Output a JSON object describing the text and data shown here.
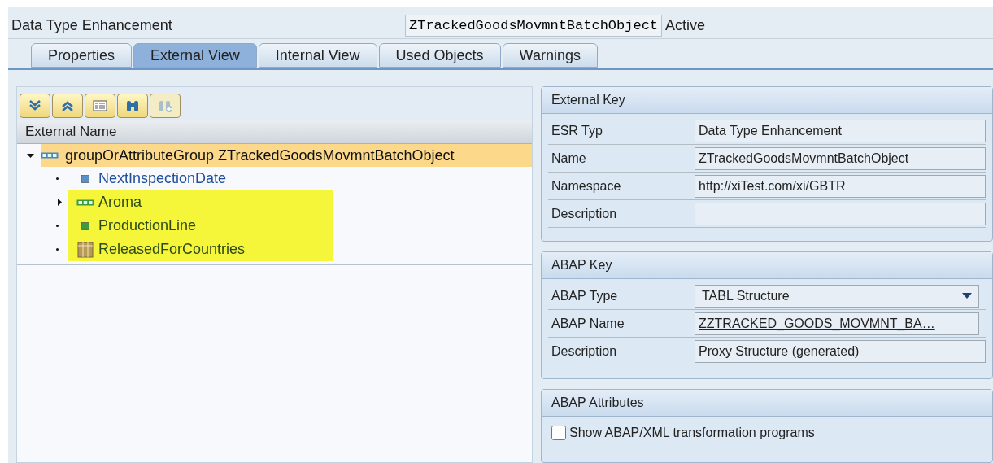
{
  "header": {
    "label": "Data Type Enhancement",
    "object_name": "ZTrackedGoodsMovmntBatchObject",
    "status": "Active"
  },
  "tabs": [
    {
      "label": "Properties",
      "selected": false
    },
    {
      "label": "External View",
      "selected": true
    },
    {
      "label": "Internal View",
      "selected": false
    },
    {
      "label": "Used Objects",
      "selected": false
    },
    {
      "label": "Warnings",
      "selected": false
    }
  ],
  "toolbar": [
    {
      "kind": "expand",
      "disabled": false
    },
    {
      "kind": "collapse",
      "disabled": false
    },
    {
      "kind": "details",
      "disabled": false
    },
    {
      "kind": "find",
      "disabled": false
    },
    {
      "kind": "find-next",
      "disabled": true
    }
  ],
  "tree": {
    "column": "External Name",
    "root": {
      "name": "groupOrAttributeGroup ZTrackedGoodsMovmntBatchObject",
      "expanded": true,
      "selected": true,
      "children": [
        {
          "name": "NextInspectionDate",
          "kind": "element",
          "color": "#5b8fc7",
          "highlighted": false
        },
        {
          "name": "Aroma",
          "kind": "group",
          "color": "#3f9a3f",
          "expanded": false,
          "highlighted": true
        },
        {
          "name": "ProductionLine",
          "kind": "element",
          "color": "#3f9a3f",
          "highlighted": true
        },
        {
          "name": "ReleasedForCountries",
          "kind": "table",
          "color": "#b89a5a",
          "highlighted": true
        }
      ]
    }
  },
  "external_key": {
    "title": "External Key",
    "fields": [
      {
        "label": "ESR Typ",
        "value": "Data Type Enhancement"
      },
      {
        "label": "Name",
        "value": "ZTrackedGoodsMovmntBatchObject"
      },
      {
        "label": "Namespace",
        "value": "http://xiTest.com/xi/GBTR"
      },
      {
        "label": "Description"
      }
    ]
  },
  "abap_key": {
    "title": "ABAP Key",
    "fields": [
      {
        "label": "ABAP Type",
        "value": "TABL Structure",
        "kind": "dropdown"
      },
      {
        "label": "ABAP Name",
        "value": "ZZTRACKED_GOODS_MOVMNT_BA…",
        "kind": "link"
      },
      {
        "label": "Description",
        "value": "Proxy Structure (generated)",
        "kind": "text"
      }
    ]
  },
  "abap_attributes": {
    "title": "ABAP Attributes",
    "checkbox": {
      "label": "Show ABAP/XML transformation programs",
      "checked": false
    }
  }
}
